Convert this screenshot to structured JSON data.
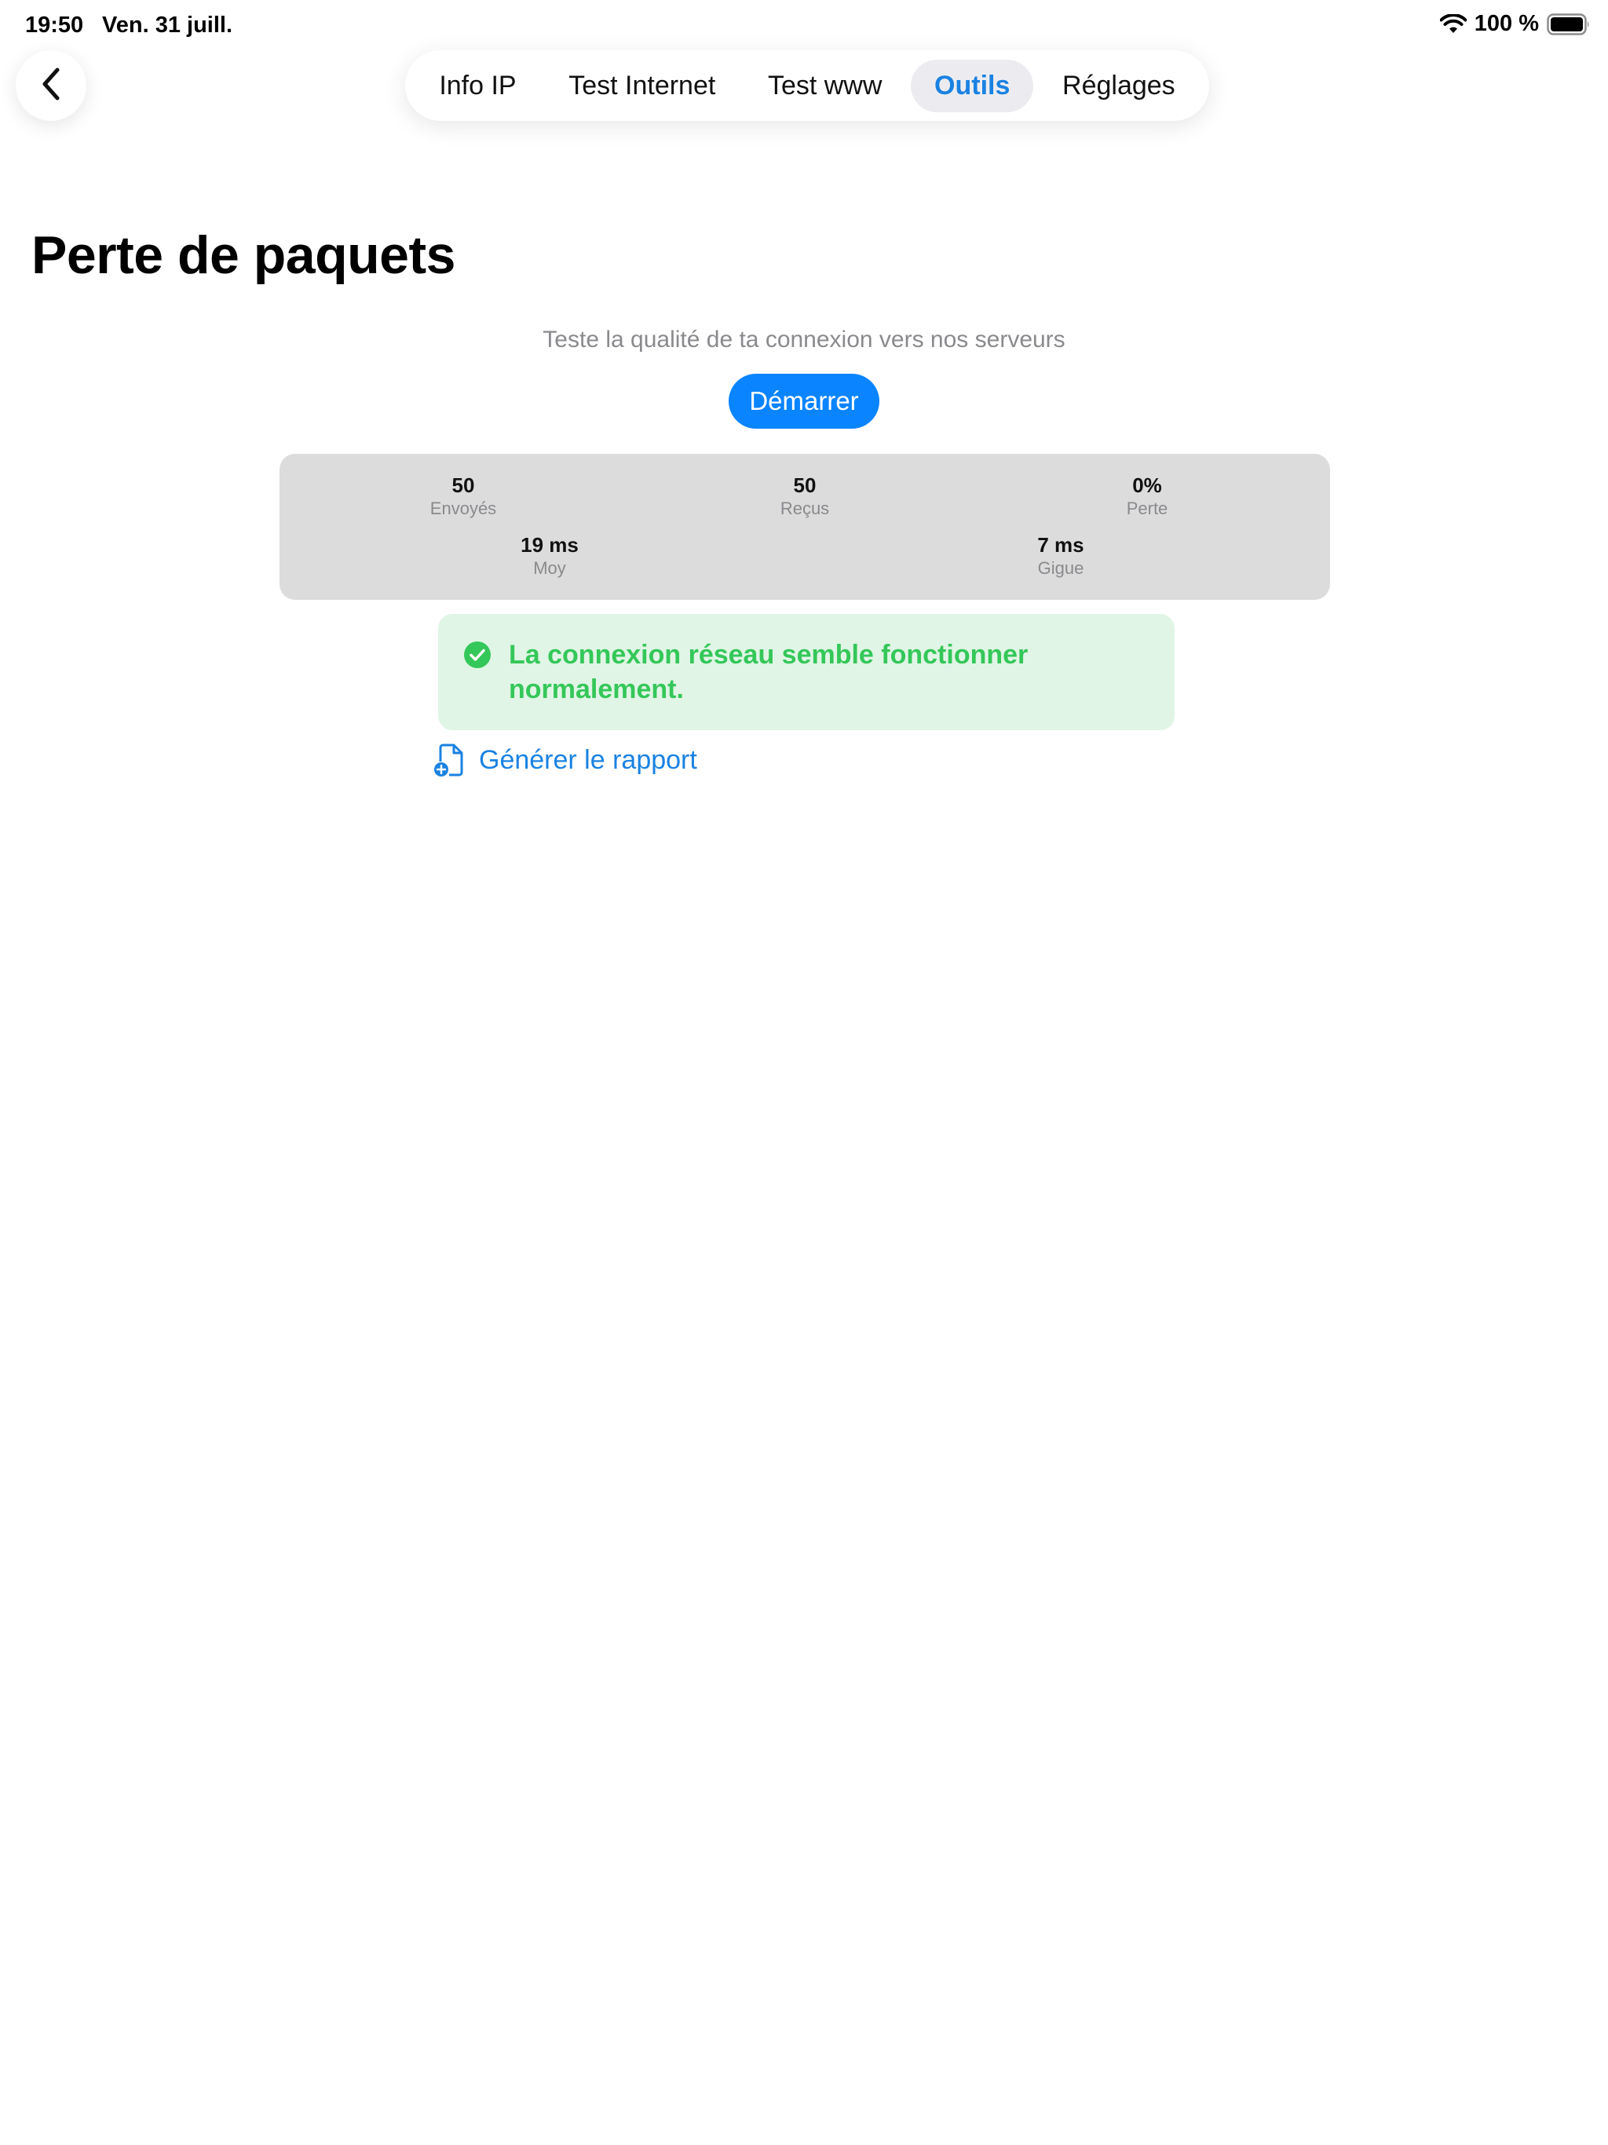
{
  "status_bar": {
    "time": "19:50",
    "date": "Ven. 31 juill.",
    "battery": "100 %",
    "wifi_icon": "wifi-icon",
    "battery_icon": "battery-icon"
  },
  "nav": {
    "back_icon": "chevron-left-icon",
    "tabs": [
      {
        "label": "Info IP",
        "active": false
      },
      {
        "label": "Test Internet",
        "active": false
      },
      {
        "label": "Test www",
        "active": false
      },
      {
        "label": "Outils",
        "active": true
      },
      {
        "label": "Réglages",
        "active": false
      }
    ]
  },
  "main": {
    "title": "Perte de paquets",
    "subtitle": "Teste la qualité de ta connexion vers nos serveurs",
    "start_label": "Démarrer",
    "stats": {
      "sent": {
        "value": "50",
        "label": "Envoyés"
      },
      "received": {
        "value": "50",
        "label": "Reçus"
      },
      "loss": {
        "value": "0%",
        "label": "Perte"
      },
      "avg": {
        "value": "19 ms",
        "label": "Moy"
      },
      "jitter": {
        "value": "7 ms",
        "label": "Gigue"
      }
    },
    "result_line1": "La connexion réseau semble fonctionner",
    "result_line2": "normalement.",
    "report_label": "Générer le rapport"
  },
  "colors": {
    "accent": "#0a84ff",
    "success": "#34c759",
    "success_bg": "#e0f5e5",
    "panel_bg": "#dcdcdc"
  }
}
